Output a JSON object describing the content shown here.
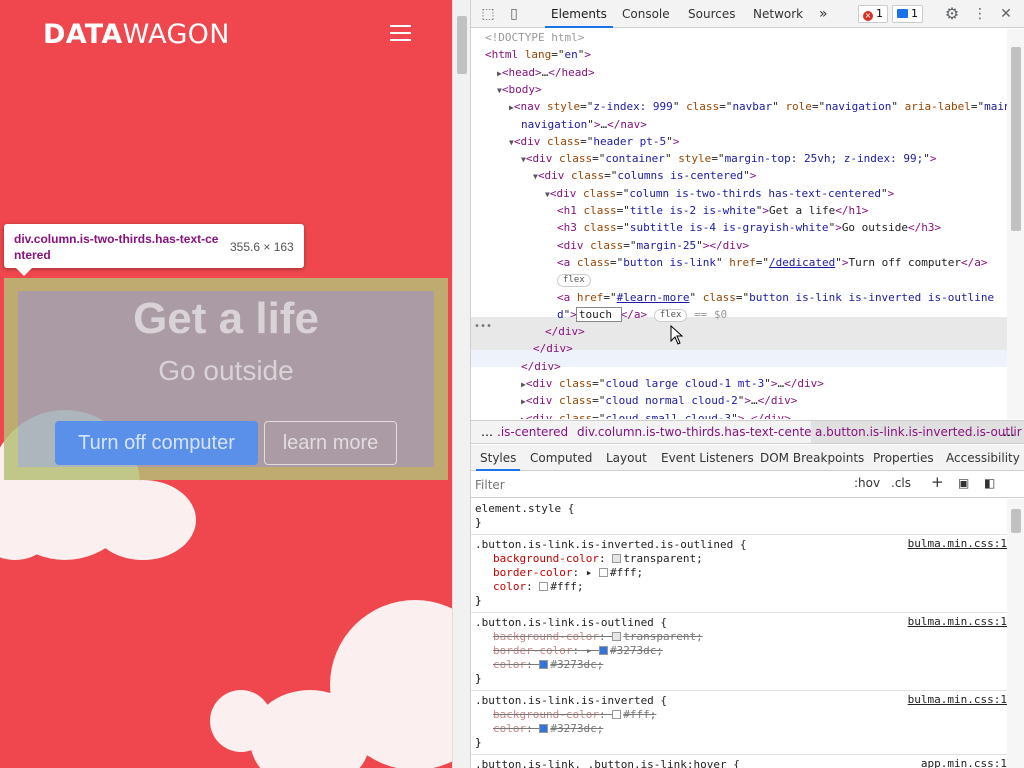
{
  "page": {
    "logo_bold": "DATA",
    "logo_light": "WAGON",
    "hero_title": "Get a life",
    "hero_subtitle": "Go outside",
    "primary_button": "Turn off computer",
    "secondary_button": "learn more",
    "tooltip": {
      "selector": "div.column.is-two-thirds.has-text-centered",
      "size": "355.6 × 163"
    }
  },
  "devtools": {
    "tabs": [
      "Elements",
      "Console",
      "Sources",
      "Network"
    ],
    "more_tabs": "»",
    "error_count": "1",
    "message_count": "1",
    "dom": [
      {
        "indent": 0,
        "html": "<span class='cmt'>&lt;!DOCTYPE html&gt;</span>"
      },
      {
        "indent": 0,
        "html": "<span class='tag'>&lt;html</span> <span class='attr'>lang</span>=\"<span class='val'>en</span>\"<span class='tag'>&gt;</span>"
      },
      {
        "indent": 1,
        "html": "<span class='tri'>▶</span><span class='tag'>&lt;head&gt;</span>…<span class='tag'>&lt;/head&gt;</span>"
      },
      {
        "indent": 1,
        "html": "<span class='tri'>▼</span><span class='tag'>&lt;body&gt;</span>"
      },
      {
        "indent": 2,
        "html": "<span class='tri'>▶</span><span class='tag'>&lt;nav</span> <span class='attr'>style</span>=\"<span class='val'>z-index: 999</span>\" <span class='attr'>class</span>=\"<span class='val'>navbar</span>\" <span class='attr'>role</span>=\"<span class='val'>navigation</span>\" <span class='attr'>aria-label</span>=\"<span class='val'>main</span>"
      },
      {
        "indent": 3,
        "html": "<span class='val'>navigation</span>\"<span class='tag'>&gt;</span>…<span class='tag'>&lt;/nav&gt;</span>"
      },
      {
        "indent": 2,
        "html": "<span class='tri'>▼</span><span class='tag'>&lt;div</span> <span class='attr'>class</span>=\"<span class='val'>header pt-5</span>\"<span class='tag'>&gt;</span>"
      },
      {
        "indent": 3,
        "html": "<span class='tri'>▼</span><span class='tag'>&lt;div</span> <span class='attr'>class</span>=\"<span class='val'>container</span>\" <span class='attr'>style</span>=\"<span class='val'>margin-top: 25vh; z-index: 99;</span>\"<span class='tag'>&gt;</span>"
      },
      {
        "indent": 4,
        "html": "<span class='tri'>▼</span><span class='tag'>&lt;div</span> <span class='attr'>class</span>=\"<span class='val'>columns is-centered</span>\"<span class='tag'>&gt;</span>"
      },
      {
        "indent": 5,
        "html": "<span class='tri'>▼</span><span class='tag'>&lt;div</span> <span class='attr'>class</span>=\"<span class='val'>column is-two-thirds has-text-centered</span>\"<span class='tag'>&gt;</span>"
      },
      {
        "indent": 6,
        "html": "<span class='tag'>&lt;h1</span> <span class='attr'>class</span>=\"<span class='val'>title is-2 is-white</span>\"<span class='tag'>&gt;</span>Get a life<span class='tag'>&lt;/h1&gt;</span>"
      },
      {
        "indent": 6,
        "html": "<span class='tag'>&lt;h3</span> <span class='attr'>class</span>=\"<span class='val'>subtitle is-4 is-grayish-white</span>\"<span class='tag'>&gt;</span>Go outside<span class='tag'>&lt;/h3&gt;</span>"
      },
      {
        "indent": 6,
        "html": "<span class='tag'>&lt;div</span> <span class='attr'>class</span>=\"<span class='val'>margin-25</span>\"<span class='tag'>&gt;&lt;/div&gt;</span>"
      },
      {
        "indent": 6,
        "html": "<span class='tag'>&lt;a</span> <span class='attr'>class</span>=\"<span class='val'>button is-link</span>\" <span class='attr'>href</span>=\"<span class='link'>/dedicated</span>\"<span class='tag'>&gt;</span>Turn off computer<span class='tag'>&lt;/a&gt;</span>"
      },
      {
        "indent": 6,
        "html": "<span class='flex-pill'>flex</span>"
      },
      {
        "indent": 6,
        "html": "<span class='tag'>&lt;a</span> <span class='attr'>href</span>=\"<span class='link'>#learn-more</span>\" <span class='attr'>class</span>=\"<span class='val'>button is-link is-inverted is-outline</span>"
      },
      {
        "indent": 6,
        "html": "<span class='val'>d</span>\"<span class='tag'>&gt;</span><span class='edit-box'>touch </span><span class='tag'>&lt;/a&gt;</span> <span class='flex-pill'>flex</span> <span class='cmt'>== $0</span>"
      },
      {
        "indent": 5,
        "html": "<span class='tag'>&lt;/div&gt;</span>"
      },
      {
        "indent": 4,
        "html": "<span class='tag'>&lt;/div&gt;</span>"
      },
      {
        "indent": 3,
        "html": "<span class='tag'>&lt;/div&gt;</span>"
      },
      {
        "indent": 3,
        "html": "<span class='tri'>▶</span><span class='tag'>&lt;div</span> <span class='attr'>class</span>=\"<span class='val'>cloud large cloud-1 mt-3</span>\"<span class='tag'>&gt;</span>…<span class='tag'>&lt;/div&gt;</span>"
      },
      {
        "indent": 3,
        "html": "<span class='tri'>▶</span><span class='tag'>&lt;div</span> <span class='attr'>class</span>=\"<span class='val'>cloud normal cloud-2</span>\"<span class='tag'>&gt;</span>…<span class='tag'>&lt;/div&gt;</span>"
      },
      {
        "indent": 3,
        "html": "<span class='tri'>▶</span><span class='tag'>&lt;div</span> <span class='attr'>class</span>=\"<span class='val'>cloud small cloud-3</span>\"<span class='tag'>&gt;</span>…<span class='tag'>&lt;/div&gt;</span>"
      }
    ],
    "breadcrumbs": [
      ".is-centered",
      "div.column.is-two-thirds.has-text-centered",
      "a.button.is-link.is-inverted.is-outlir"
    ],
    "breadcrumb_more": "…",
    "subtabs": [
      "Styles",
      "Computed",
      "Layout",
      "Event Listeners",
      "DOM Breakpoints",
      "Properties",
      "Accessibility"
    ],
    "filter_placeholder": "Filter",
    "hov": ":hov",
    "cls": ".cls",
    "rules": [
      {
        "selector": "element.style {",
        "source": "",
        "props": []
      },
      {
        "selector": ".button.is-link.is-inverted.is-outlined {",
        "source": "bulma.min.css:1",
        "props": [
          {
            "name": "background-color",
            "value": "transparent",
            "swatch": "#e6e6e6",
            "strike": false,
            "tri": false
          },
          {
            "name": "border-color",
            "value": "#fff",
            "swatch": "#ffffff",
            "strike": false,
            "tri": true
          },
          {
            "name": "color",
            "value": "#fff",
            "swatch": "#ffffff",
            "strike": false,
            "tri": false
          }
        ]
      },
      {
        "selector": ".button.is-link.is-outlined {",
        "source": "bulma.min.css:1",
        "props": [
          {
            "name": "background-color",
            "value": "transparent",
            "swatch": "#e6e6e6",
            "strike": true,
            "tri": false
          },
          {
            "name": "border-color",
            "value": "#3273dc",
            "swatch": "#3273dc",
            "strike": true,
            "tri": true
          },
          {
            "name": "color",
            "value": "#3273dc",
            "swatch": "#3273dc",
            "strike": true,
            "tri": false
          }
        ]
      },
      {
        "selector": ".button.is-link.is-inverted {",
        "source": "bulma.min.css:1",
        "props": [
          {
            "name": "background-color",
            "value": "#fff",
            "swatch": "#ffffff",
            "strike": true,
            "tri": false
          },
          {
            "name": "color",
            "value": "#3273dc",
            "swatch": "#3273dc",
            "strike": true,
            "tri": false
          }
        ]
      },
      {
        "selector": ".button.is-link, .button.is-link:hover {",
        "source": "app.min.css:1",
        "props": []
      }
    ]
  },
  "colors": {
    "page_bg": "#ef474d",
    "accent": "#1a73e8",
    "button_blue": "#5b90ea"
  }
}
